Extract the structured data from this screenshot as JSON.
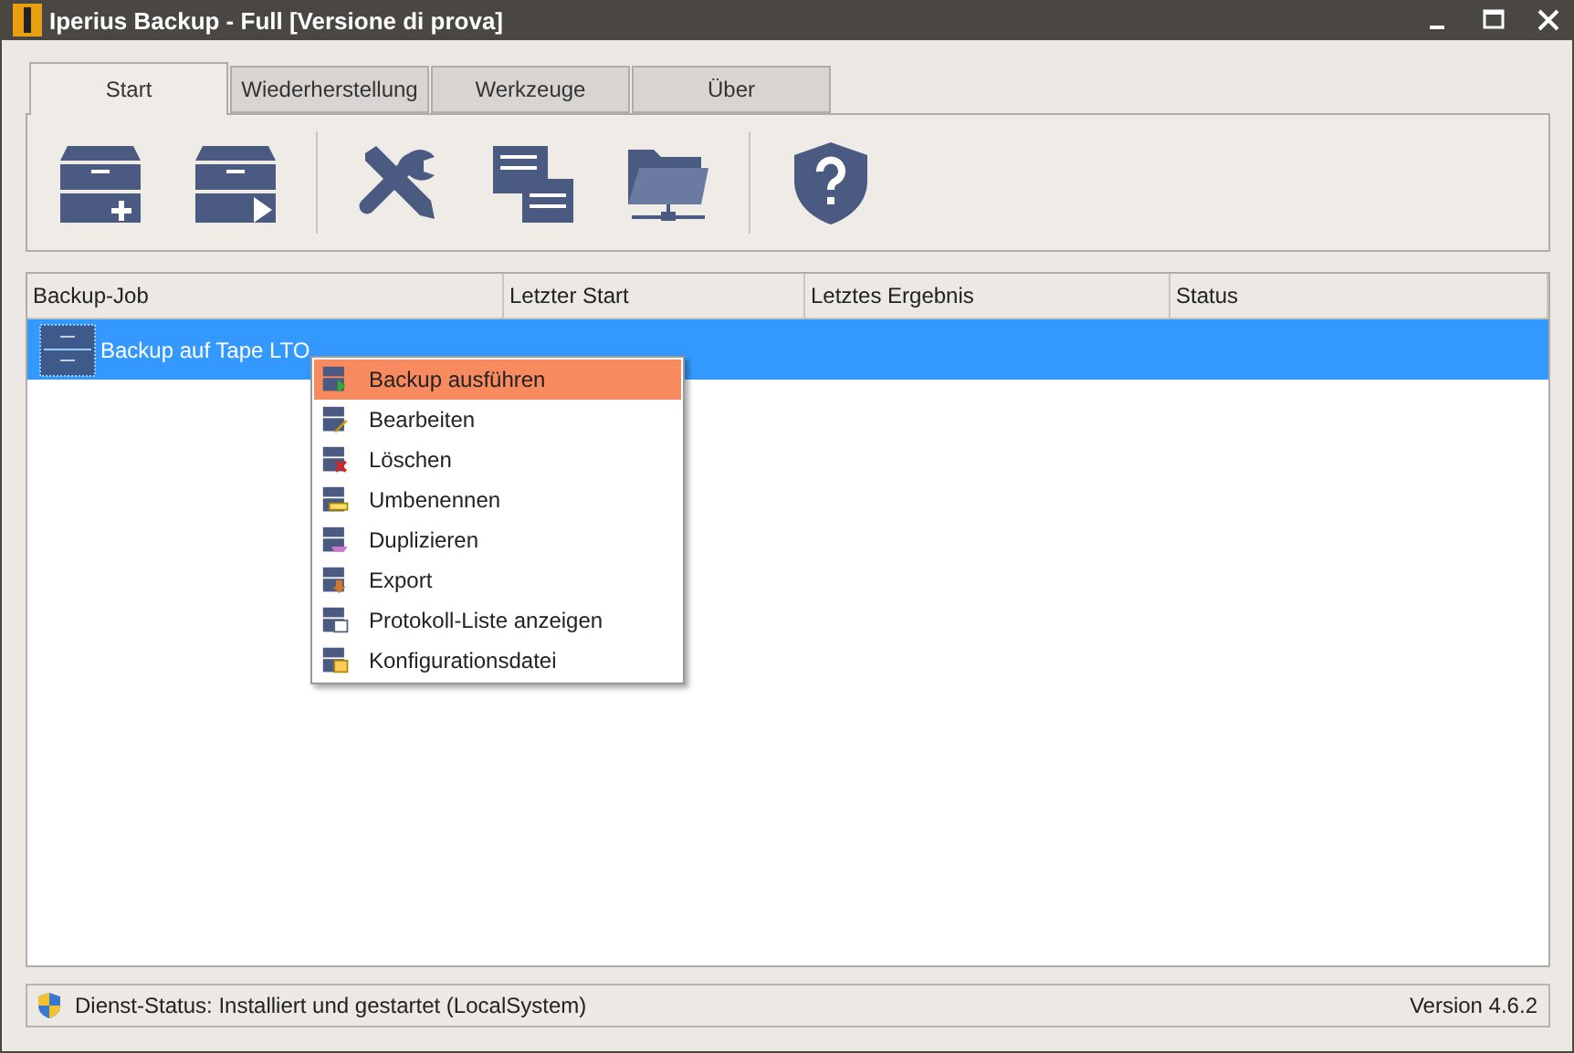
{
  "window": {
    "title": "Iperius Backup - Full  [Versione di prova]"
  },
  "tabs": [
    {
      "label": "Start",
      "selected": true
    },
    {
      "label": "Wiederherstellung",
      "selected": false
    },
    {
      "label": "Werkzeuge",
      "selected": false
    },
    {
      "label": "Über",
      "selected": false
    }
  ],
  "toolbar": [
    {
      "kind": "new-job"
    },
    {
      "kind": "run-job"
    },
    {
      "kind": "separator"
    },
    {
      "kind": "tools"
    },
    {
      "kind": "logs"
    },
    {
      "kind": "network-folder"
    },
    {
      "kind": "separator"
    },
    {
      "kind": "help"
    }
  ],
  "table": {
    "columns": [
      "Backup-Job",
      "Letzter Start",
      "Letztes Ergebnis",
      "Status"
    ],
    "rows": [
      {
        "cells": [
          "Backup auf Tape LTO"
        ],
        "selected": true
      }
    ]
  },
  "context_menu": [
    {
      "label": "Backup ausführen",
      "selected": true,
      "kind": "run"
    },
    {
      "label": "Bearbeiten",
      "selected": false,
      "kind": "edit"
    },
    {
      "label": "Löschen",
      "selected": false,
      "kind": "delete"
    },
    {
      "label": "Umbenennen",
      "selected": false,
      "kind": "rename"
    },
    {
      "label": "Duplizieren",
      "selected": false,
      "kind": "duplicate"
    },
    {
      "label": "Export",
      "selected": false,
      "kind": "export"
    },
    {
      "label": "Protokoll-Liste anzeigen",
      "selected": false,
      "kind": "log"
    },
    {
      "label": "Konfigurationsdatei",
      "selected": false,
      "kind": "config"
    }
  ],
  "status_bar": {
    "service_status": "Dienst-Status: Installiert und gestartet (LocalSystem)",
    "version": "Version 4.6.2"
  }
}
